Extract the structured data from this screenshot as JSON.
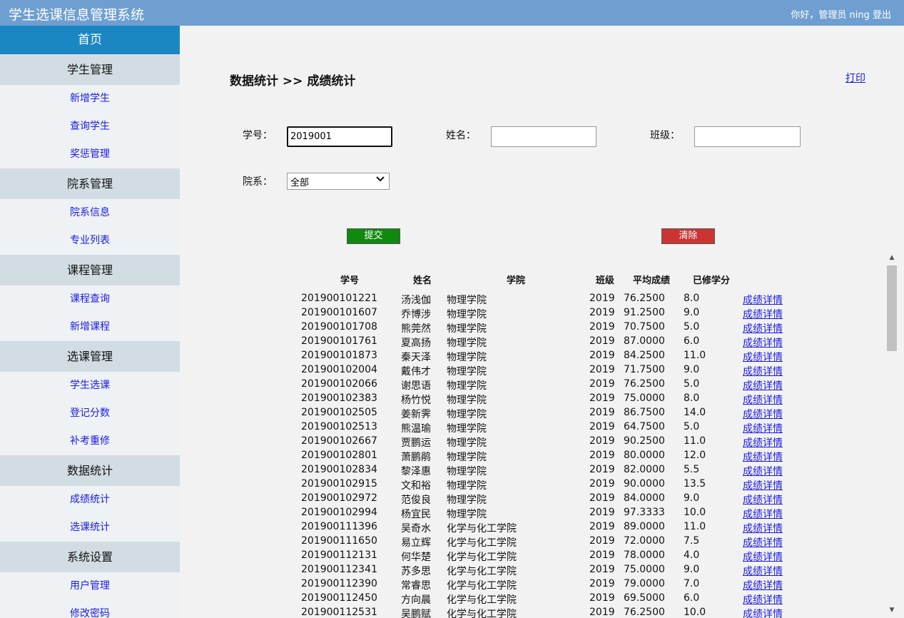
{
  "header": {
    "title": "学生选课信息管理系统",
    "greeting": "你好，管理员 ning",
    "logout": "登出"
  },
  "sidebar": {
    "home": "首页",
    "groups": [
      {
        "label": "学生管理",
        "items": [
          "新增学生",
          "查询学生",
          "奖惩管理"
        ]
      },
      {
        "label": "院系管理",
        "items": [
          "院系信息",
          "专业列表"
        ]
      },
      {
        "label": "课程管理",
        "items": [
          "课程查询",
          "新增课程"
        ]
      },
      {
        "label": "选课管理",
        "items": [
          "学生选课",
          "登记分数",
          "补考重修"
        ]
      },
      {
        "label": "数据统计",
        "items": [
          "成绩统计",
          "选课统计"
        ]
      },
      {
        "label": "系统设置",
        "items": [
          "用户管理",
          "修改密码"
        ]
      }
    ]
  },
  "page": {
    "breadcrumb": "数据统计 >> 成绩统计",
    "print": "打印"
  },
  "form": {
    "student_id_label": "学号：",
    "student_id_value": "2019001",
    "name_label": "姓名：",
    "name_value": "",
    "class_label": "班级：",
    "class_value": "",
    "dept_label": "院系：",
    "dept_selected": "全部",
    "submit": "提交",
    "clear": "清除"
  },
  "table": {
    "columns": [
      "学号",
      "姓名",
      "学院",
      "班级",
      "平均成绩",
      "已修学分"
    ],
    "link_text": "成绩详情",
    "rows": [
      [
        "201900101221",
        "汤浅伽",
        "物理学院",
        "2019",
        "76.2500",
        "8.0"
      ],
      [
        "201900101607",
        "乔博涉",
        "物理学院",
        "2019",
        "91.2500",
        "9.0"
      ],
      [
        "201900101708",
        "熊莞然",
        "物理学院",
        "2019",
        "70.7500",
        "5.0"
      ],
      [
        "201900101761",
        "夏高扬",
        "物理学院",
        "2019",
        "87.0000",
        "6.0"
      ],
      [
        "201900101873",
        "秦天泽",
        "物理学院",
        "2019",
        "84.2500",
        "11.0"
      ],
      [
        "201900102004",
        "戴伟才",
        "物理学院",
        "2019",
        "71.7500",
        "9.0"
      ],
      [
        "201900102066",
        "谢思语",
        "物理学院",
        "2019",
        "76.2500",
        "5.0"
      ],
      [
        "201900102383",
        "杨竹悦",
        "物理学院",
        "2019",
        "75.0000",
        "8.0"
      ],
      [
        "201900102505",
        "姜新霁",
        "物理学院",
        "2019",
        "86.7500",
        "14.0"
      ],
      [
        "201900102513",
        "熊温瑜",
        "物理学院",
        "2019",
        "64.7500",
        "5.0"
      ],
      [
        "201900102667",
        "贾鹏运",
        "物理学院",
        "2019",
        "90.2500",
        "11.0"
      ],
      [
        "201900102801",
        "萧鹏鹃",
        "物理学院",
        "2019",
        "80.0000",
        "12.0"
      ],
      [
        "201900102834",
        "黎泽惠",
        "物理学院",
        "2019",
        "82.0000",
        "5.5"
      ],
      [
        "201900102915",
        "文和裕",
        "物理学院",
        "2019",
        "90.0000",
        "13.5"
      ],
      [
        "201900102972",
        "范俊良",
        "物理学院",
        "2019",
        "84.0000",
        "9.0"
      ],
      [
        "201900102994",
        "杨宜民",
        "物理学院",
        "2019",
        "97.3333",
        "10.0"
      ],
      [
        "201900111396",
        "吴奇水",
        "化学与化工学院",
        "2019",
        "89.0000",
        "11.0"
      ],
      [
        "201900111650",
        "易立辉",
        "化学与化工学院",
        "2019",
        "72.0000",
        "7.5"
      ],
      [
        "201900112131",
        "何华楚",
        "化学与化工学院",
        "2019",
        "78.0000",
        "4.0"
      ],
      [
        "201900112341",
        "苏多思",
        "化学与化工学院",
        "2019",
        "75.0000",
        "9.0"
      ],
      [
        "201900112390",
        "常睿思",
        "化学与化工学院",
        "2019",
        "79.0000",
        "7.0"
      ],
      [
        "201900112450",
        "方向晨",
        "化学与化工学院",
        "2019",
        "69.5000",
        "6.0"
      ],
      [
        "201900112531",
        "吴鹏赋",
        "化学与化工学院",
        "2019",
        "76.2500",
        "10.0"
      ]
    ]
  },
  "icons": {
    "select_chevron": "chevron-down-icon",
    "scroll_up": "arrow-up-icon",
    "scroll_down": "arrow-down-icon"
  },
  "colors": {
    "header": "#6f9fd0",
    "nav_home": "#1a87c2",
    "nav_group": "#d1dde2",
    "link": "#1a1ae6",
    "submit": "#0f8a0f",
    "clear": "#cc3333"
  }
}
